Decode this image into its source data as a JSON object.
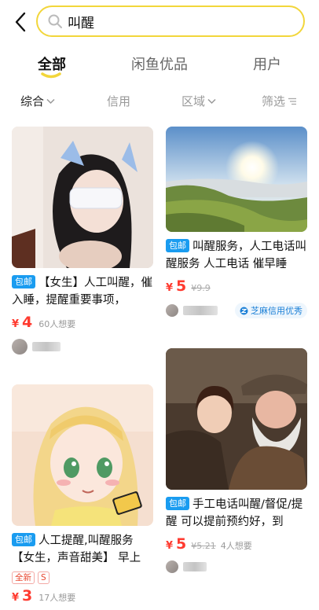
{
  "search": {
    "query": "叫醒"
  },
  "main_tabs": [
    {
      "label": "全部",
      "active": true
    },
    {
      "label": "闲鱼优品",
      "active": false
    },
    {
      "label": "用户",
      "active": false
    }
  ],
  "filters": [
    {
      "label": "综合",
      "active": true
    },
    {
      "label": "信用",
      "active": false
    },
    {
      "label": "区域",
      "active": false
    },
    {
      "label": "筛选",
      "active": false
    }
  ],
  "accent_color": "#f2d63b",
  "price_color": "#ff3b30",
  "products": [
    {
      "badge": "包邮",
      "title": "【女生】人工叫醒，催入睡，提醒重要事项，",
      "currency": "¥",
      "price": "4",
      "original_price": "",
      "wants": "60人想要"
    },
    {
      "badge": "包邮",
      "title": "叫醒服务，人工电话叫醒服务 人工电话 催早睡",
      "currency": "¥",
      "price": "5",
      "original_price": "¥9.9",
      "wants": "",
      "credit_label": "芝麻信用优秀"
    },
    {
      "badge": "包邮",
      "title": "人工提醒,叫醒服务【女生，声音甜美】 早上",
      "tags": [
        "全新",
        "S"
      ],
      "currency": "¥",
      "price": "3",
      "original_price": "",
      "wants": "17人想要"
    },
    {
      "badge": "包邮",
      "title": "手工电话叫醒/督促/提醒 可以提前预约好，到",
      "currency": "¥",
      "price": "5",
      "original_price": "¥5.21",
      "wants": "4人想要"
    }
  ]
}
